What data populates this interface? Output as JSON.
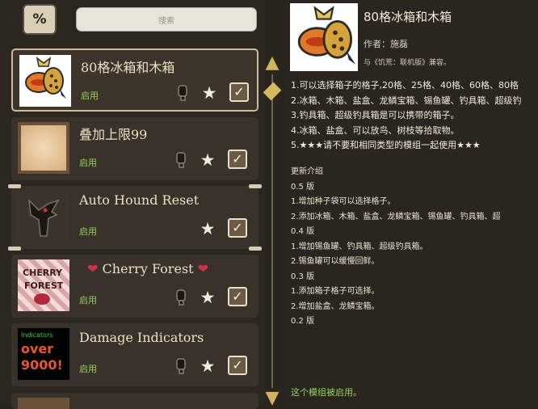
{
  "search": {
    "placeholder": "搜索"
  },
  "sort_button": {
    "label": "%"
  },
  "mods": [
    {
      "name": "80格冰箱和木箱",
      "status": "启用",
      "selected": true,
      "enabled": true,
      "has_client_icon": true,
      "has_brackets": false
    },
    {
      "name": "叠加上限99",
      "status": "启用",
      "selected": false,
      "enabled": true,
      "has_client_icon": true,
      "has_brackets": false
    },
    {
      "name": "Auto Hound Reset",
      "status": "启用",
      "selected": false,
      "enabled": true,
      "has_client_icon": false,
      "has_brackets": true
    },
    {
      "name": "Cherry Forest",
      "status": "启用",
      "selected": false,
      "enabled": true,
      "has_client_icon": true,
      "has_brackets": false
    },
    {
      "name": "Damage Indicators",
      "status": "启用",
      "selected": false,
      "enabled": true,
      "has_client_icon": true,
      "has_brackets": false
    }
  ],
  "thumb_text": {
    "damage": [
      "Indicators",
      "over",
      "9000!"
    ],
    "cherry": [
      "CHERRY",
      "FOREST"
    ]
  },
  "detail": {
    "title": "80格冰箱和木箱",
    "author": "作者：施磊",
    "compat": "与《饥荒：联机版》兼容。",
    "description": [
      "1.可以选择箱子的格子,20格、25格、40格、60格、80格",
      "2.冰箱、木箱、盐盒、龙鳞宝箱、锡鱼罐、钓具箱、超级钓",
      "3.钓具箱、超级钓具箱是可以携带的箱子。",
      "4.冰箱、盐盒、可以放鸟、树枝等拾取物。",
      "5.★★★请不要和相同类型的模组一起使用★★★"
    ],
    "changelog": [
      "更新介绍",
      "0.5 版",
      "1.增加种子袋可以选择格子。",
      "2.添加冰箱、木箱、盐盒、龙鳞宝箱、锡鱼罐、钓具箱、超",
      "0.4 版",
      "1.增加锡鱼罐、钓具箱、超级钓具箱。",
      "2.锡鱼罐可以缓慢回鲜。",
      "0.3 版",
      "1.添加箱子格子可选择。",
      "2.增加盐盒、龙鳞宝箱。",
      "0.2 版"
    ],
    "enabled_message": "这个模组被启用。"
  },
  "colors": {
    "enabled_green": "#8fd45c",
    "panel_bg": "#2c2620",
    "accent_gold": "#d2b25f"
  }
}
